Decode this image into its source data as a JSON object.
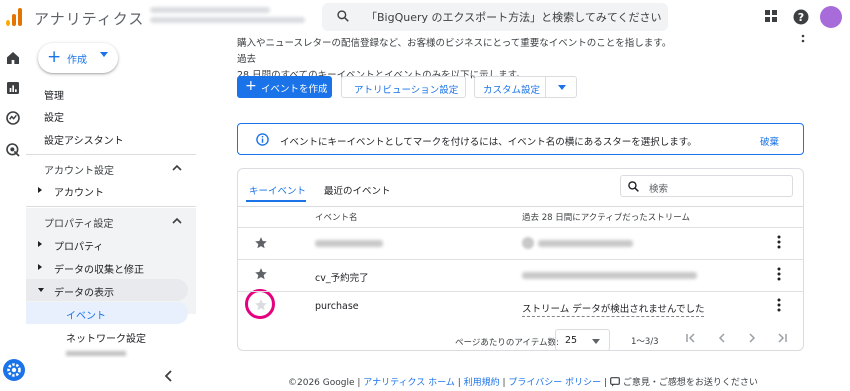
{
  "header": {
    "app_title": "アナリティクス",
    "search_placeholder": "「BigQuery のエクスポート方法」と検索してみてください"
  },
  "sidebar": {
    "create_label": "作成",
    "items": [
      {
        "label": "管理"
      },
      {
        "label": "設定"
      },
      {
        "label": "設定アシスタント"
      }
    ],
    "account_section": "アカウント設定",
    "account_items": [
      {
        "label": "アカウント"
      }
    ],
    "property_section": "プロパティ設定",
    "property_items": [
      {
        "label": "プロパティ"
      },
      {
        "label": "データの収集と修正"
      },
      {
        "label": "データの表示"
      }
    ],
    "display_subitems": [
      {
        "label": "イベント"
      },
      {
        "label": "ネットワーク設定"
      }
    ]
  },
  "main": {
    "intro_line1": "購入やニュースレターの配信登録など、お客様のビジネスにとって重要なイベントのことを指します。過去",
    "intro_line2": "28 日間のすべてのキーイベントとイベントのみを以下に示します。",
    "buttons": {
      "create_event": "イベントを作成",
      "attribution": "アトリビューション設定",
      "custom": "カスタム設定"
    },
    "banner": {
      "text": "イベントにキーイベントとしてマークを付けるには、イベント名の横にあるスターを選択します。",
      "dismiss": "破棄"
    },
    "tabs": [
      {
        "label": "キーイベント"
      },
      {
        "label": "最近のイベント"
      }
    ],
    "table_search_placeholder": "検索",
    "columns": {
      "event_name": "イベント名",
      "streams": "過去 28 日間にアクティブだったストリーム"
    },
    "rows": [
      {
        "name": "",
        "stream": "",
        "key_event": true
      },
      {
        "name": "cv_予約完了",
        "stream": "",
        "key_event": true
      },
      {
        "name": "purchase",
        "stream": "ストリーム データが検出されませんでした",
        "key_event": false
      }
    ],
    "pagination": {
      "rows_per_page_label": "ページあたりのアイテム数:",
      "rows_per_page": "25",
      "range": "1〜3/3"
    }
  },
  "footer": {
    "copyright": "©2026 Google | ",
    "link_home": "アナリティクス ホーム",
    "sep1": " | ",
    "link_terms": "利用規約",
    "sep2": " | ",
    "link_privacy": "プライバシー ポリシー",
    "sep3": " | ",
    "feedback": "ご意見・ご感想をお送りください"
  },
  "colors": {
    "accent": "#1a73e8",
    "highlight_ring": "#e4007f",
    "selected_nav_bg": "#e8f0fe"
  }
}
